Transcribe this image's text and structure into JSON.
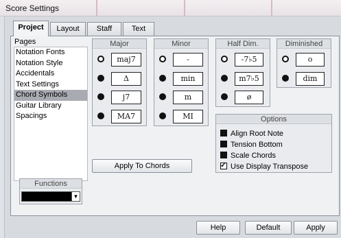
{
  "window": {
    "title": "Score Settings"
  },
  "tabs": [
    {
      "label": "Project",
      "active": true
    },
    {
      "label": "Layout",
      "active": false
    },
    {
      "label": "Staff",
      "active": false
    },
    {
      "label": "Text",
      "active": false
    }
  ],
  "pages": {
    "header": "Pages",
    "items": [
      "Notation Fonts",
      "Notation Style",
      "Accidentals",
      "Text Settings",
      "Chord Symbols",
      "Guitar Library",
      "Spacings"
    ],
    "selected": "Chord Symbols"
  },
  "chord_groups": {
    "major": {
      "label": "Major",
      "options": [
        "maj7",
        "Δ",
        "j7",
        "MA7"
      ],
      "selected_index": 0
    },
    "minor": {
      "label": "Minor",
      "options": [
        "-",
        "min",
        "m",
        "MI"
      ],
      "selected_index": 0
    },
    "half_dim": {
      "label": "Half Dim.",
      "options": [
        "-7♭5",
        "m7♭5",
        "ø"
      ],
      "selected_index": 0
    },
    "diminished": {
      "label": "Diminished",
      "options": [
        "o",
        "dim"
      ],
      "selected_index": 0
    }
  },
  "options": {
    "label": "Options",
    "items": [
      {
        "label": "Align Root Note",
        "checked": false
      },
      {
        "label": "Tension Bottom",
        "checked": false
      },
      {
        "label": "Scale Chords",
        "checked": false
      },
      {
        "label": "Use Display Transpose",
        "checked": true
      }
    ]
  },
  "apply_to_chords": "Apply To Chords",
  "functions": {
    "label": "Functions",
    "value": ""
  },
  "footer": {
    "help": "Help",
    "default": "Default",
    "apply": "Apply"
  }
}
